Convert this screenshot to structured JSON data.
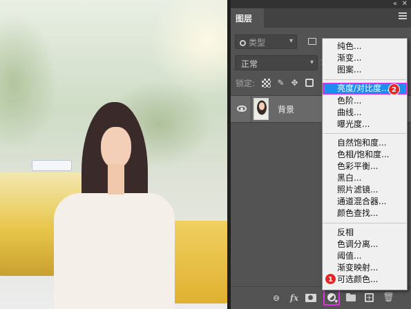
{
  "panel": {
    "collapse_glyph": "«",
    "close_glyph": "✕",
    "tab_label": "图层",
    "filter_kind": "类型",
    "blend_mode": "正常",
    "opacity_stub": "1",
    "lock_label": "锁定:",
    "layer": {
      "name": "背景"
    }
  },
  "adjustment_menu": {
    "groups": [
      [
        "纯色...",
        "渐变...",
        "图案..."
      ],
      [
        "亮度/对比度...",
        "色阶...",
        "曲线...",
        "曝光度..."
      ],
      [
        "自然饱和度...",
        "色相/饱和度...",
        "色彩平衡...",
        "黑白...",
        "照片滤镜...",
        "通道混合器...",
        "颜色查找..."
      ],
      [
        "反相",
        "色调分离...",
        "阈值...",
        "渐变映射...",
        "可选颜色..."
      ]
    ],
    "highlighted_item": "亮度/对比度..."
  },
  "annotations": {
    "step1": "1",
    "step2": "2"
  },
  "colors": {
    "highlight_blue": "#1e8df0",
    "annotation_pink": "#e030e0",
    "badge_red": "#e4282a"
  }
}
